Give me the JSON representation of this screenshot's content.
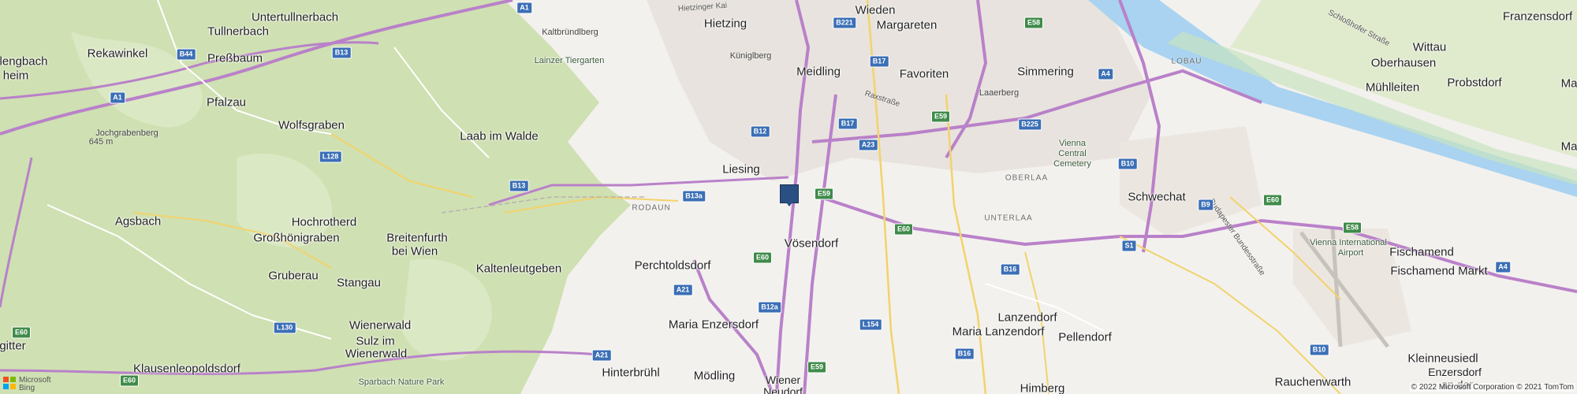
{
  "places": [
    {
      "id": "hietzing",
      "label": "Hietzing"
    },
    {
      "id": "wieden",
      "label": "Wieden"
    },
    {
      "id": "margareten",
      "label": "Margareten"
    },
    {
      "id": "meidling",
      "label": "Meidling"
    },
    {
      "id": "favoriten",
      "label": "Favoriten"
    },
    {
      "id": "simmering",
      "label": "Simmering"
    },
    {
      "id": "liesing",
      "label": "Liesing"
    },
    {
      "id": "schwechat",
      "label": "Schwechat"
    },
    {
      "id": "voesendorf",
      "label": "Vösendorf"
    },
    {
      "id": "perchtoldsdorf",
      "label": "Perchtoldsdorf"
    },
    {
      "id": "maria-enzersdorf",
      "label": "Maria Enzersdorf"
    },
    {
      "id": "hinterbruehl",
      "label": "Hinterbrühl"
    },
    {
      "id": "moedling",
      "label": "Mödling"
    },
    {
      "id": "wiener-neudorf-1",
      "label": "Wiener"
    },
    {
      "id": "wiener-neudorf-2",
      "label": "Neudorf"
    },
    {
      "id": "lanzendorf",
      "label": "Lanzendorf"
    },
    {
      "id": "maria-lanzendorf",
      "label": "Maria Lanzendorf"
    },
    {
      "id": "pellendorf",
      "label": "Pellendorf"
    },
    {
      "id": "himberg",
      "label": "Himberg"
    },
    {
      "id": "rauchenwarth",
      "label": "Rauchenwarth"
    },
    {
      "id": "fischamend",
      "label": "Fischamend"
    },
    {
      "id": "fischamend-markt",
      "label": "Fischamend Markt"
    },
    {
      "id": "kleinneusiedl",
      "label": "Kleinneusiedl"
    },
    {
      "id": "enzersdorf-1",
      "label": "Enzersdorf"
    },
    {
      "id": "enzersdorf-2",
      "label": "an der"
    },
    {
      "id": "muehlleiten",
      "label": "Mühlleiten"
    },
    {
      "id": "oberhausen",
      "label": "Oberhausen"
    },
    {
      "id": "wittau",
      "label": "Wittau"
    },
    {
      "id": "probstdorf",
      "label": "Probstdorf"
    },
    {
      "id": "franzensdorf",
      "label": "Franzensdorf"
    },
    {
      "id": "ma-1",
      "label": "Ma"
    },
    {
      "id": "ma-2",
      "label": "Ma"
    },
    {
      "id": "untertullnerbach",
      "label": "Untertullnerbach"
    },
    {
      "id": "tullnerbach",
      "label": "Tullnerbach"
    },
    {
      "id": "rekawinkel",
      "label": "Rekawinkel"
    },
    {
      "id": "pressbaum",
      "label": "Preßbaum"
    },
    {
      "id": "pfalzau",
      "label": "Pfalzau"
    },
    {
      "id": "wolfsgraben",
      "label": "Wolfsgraben"
    },
    {
      "id": "laab-im-walde",
      "label": "Laab im Walde"
    },
    {
      "id": "agsbach",
      "label": "Agsbach"
    },
    {
      "id": "hochrotherd",
      "label": "Hochrotherd"
    },
    {
      "id": "grosshoenigraben",
      "label": "Großhönigraben"
    },
    {
      "id": "breitenfurth-1",
      "label": "Breitenfurth"
    },
    {
      "id": "breitenfurth-2",
      "label": "bei Wien"
    },
    {
      "id": "kaltenleutgeben",
      "label": "Kaltenleutgeben"
    },
    {
      "id": "gruberau",
      "label": "Gruberau"
    },
    {
      "id": "stangau",
      "label": "Stangau"
    },
    {
      "id": "wienerwald",
      "label": "Wienerwald"
    },
    {
      "id": "sulz-1",
      "label": "Sulz im"
    },
    {
      "id": "sulz-2",
      "label": "Wienerwald"
    },
    {
      "id": "klausen",
      "label": "Klausenleopoldsdorf"
    },
    {
      "id": "gitter",
      "label": "gitter"
    },
    {
      "id": "lengbach",
      "label": "lengbach"
    },
    {
      "id": "heim",
      "label": "heim"
    }
  ],
  "pois": [
    {
      "id": "kaltbruendlberg",
      "label": "Kaltbründlberg"
    },
    {
      "id": "lainzer-tiergarten",
      "label": "Lainzer Tiergarten"
    },
    {
      "id": "kueniglberg",
      "label": "Küniglberg"
    },
    {
      "id": "laaerberg",
      "label": "Laaerberg"
    },
    {
      "id": "vienna-cemetery-1",
      "label": "Vienna"
    },
    {
      "id": "vienna-cemetery-2",
      "label": "Central"
    },
    {
      "id": "vienna-cemetery-3",
      "label": "Cemetery"
    },
    {
      "id": "airport-1",
      "label": "Vienna International"
    },
    {
      "id": "airport-2",
      "label": "Airport"
    },
    {
      "id": "sparbach",
      "label": "Sparbach Nature Park"
    },
    {
      "id": "jochgrabenberg-1",
      "label": "Jochgrabenberg"
    },
    {
      "id": "jochgrabenberg-2",
      "label": "645 m"
    }
  ],
  "districts": [
    {
      "id": "rodaun",
      "label": "RODAUN"
    },
    {
      "id": "oberlaa",
      "label": "OBERLAA"
    },
    {
      "id": "unterlaa",
      "label": "UNTERLAA"
    },
    {
      "id": "lobau",
      "label": "LOBAU"
    }
  ],
  "shields": [
    {
      "id": "a1-top",
      "label": "A1",
      "color": "#3b6fb6"
    },
    {
      "id": "b221",
      "label": "B221",
      "color": "#3b6fb6"
    },
    {
      "id": "e58-top",
      "label": "E58",
      "color": "#3f8b4a"
    },
    {
      "id": "b44",
      "label": "B44",
      "color": "#3b6fb6"
    },
    {
      "id": "b13-top",
      "label": "B13",
      "color": "#3b6fb6"
    },
    {
      "id": "a1-left",
      "label": "A1",
      "color": "#3b6fb6"
    },
    {
      "id": "b17-a",
      "label": "B17",
      "color": "#3b6fb6"
    },
    {
      "id": "b17-b",
      "label": "B17",
      "color": "#3b6fb6"
    },
    {
      "id": "b12",
      "label": "B12",
      "color": "#3b6fb6"
    },
    {
      "id": "a23",
      "label": "A23",
      "color": "#3b6fb6"
    },
    {
      "id": "e59-a",
      "label": "E59",
      "color": "#3f8b4a"
    },
    {
      "id": "b225",
      "label": "B225",
      "color": "#3b6fb6"
    },
    {
      "id": "a4-top",
      "label": "A4",
      "color": "#3b6fb6"
    },
    {
      "id": "l128",
      "label": "L128",
      "color": "#3b6fb6"
    },
    {
      "id": "b13-mid",
      "label": "B13",
      "color": "#3b6fb6"
    },
    {
      "id": "b13a",
      "label": "B13a",
      "color": "#3b6fb6"
    },
    {
      "id": "e59-b",
      "label": "E59",
      "color": "#3f8b4a"
    },
    {
      "id": "b10-a",
      "label": "B10",
      "color": "#3b6fb6"
    },
    {
      "id": "b9",
      "label": "B9",
      "color": "#3b6fb6"
    },
    {
      "id": "e60-a",
      "label": "E60",
      "color": "#3f8b4a"
    },
    {
      "id": "e60-b",
      "label": "E60",
      "color": "#3f8b4a"
    },
    {
      "id": "e60-c",
      "label": "E60",
      "color": "#3f8b4a"
    },
    {
      "id": "s1",
      "label": "S1",
      "color": "#3b6fb6"
    },
    {
      "id": "e58-r",
      "label": "E58",
      "color": "#3f8b4a"
    },
    {
      "id": "b16-a",
      "label": "B16",
      "color": "#3b6fb6"
    },
    {
      "id": "a21",
      "label": "A21",
      "color": "#3b6fb6"
    },
    {
      "id": "b12a",
      "label": "B12a",
      "color": "#3b6fb6"
    },
    {
      "id": "l154",
      "label": "L154",
      "color": "#3b6fb6"
    },
    {
      "id": "l130",
      "label": "L130",
      "color": "#3b6fb6"
    },
    {
      "id": "e60-l",
      "label": "E60",
      "color": "#3f8b4a"
    },
    {
      "id": "a21-b",
      "label": "A21",
      "color": "#3b6fb6"
    },
    {
      "id": "b16-b",
      "label": "B16",
      "color": "#3b6fb6"
    },
    {
      "id": "b10-b",
      "label": "B10",
      "color": "#3b6fb6"
    },
    {
      "id": "a4-r",
      "label": "A4",
      "color": "#3b6fb6"
    },
    {
      "id": "e59-c",
      "label": "E59",
      "color": "#3f8b4a"
    },
    {
      "id": "e60-bot",
      "label": "E60",
      "color": "#3f8b4a"
    }
  ],
  "roadnames": [
    {
      "id": "hietzinger-kai",
      "label": "Hietzinger Kai"
    },
    {
      "id": "raxstrasse",
      "label": "Raxstraße"
    },
    {
      "id": "budapester",
      "label": "Budapester Bundesstraße"
    },
    {
      "id": "schlosshofer",
      "label": "Schloßhofer Straße"
    }
  ],
  "pin": {
    "label": "location-pin",
    "color": "#2a4f82"
  },
  "attribution": {
    "logo_line1": "Microsoft",
    "logo_line2": "Bing",
    "copyright": "© 2022 Microsoft Corporation © 2021 TomTom"
  },
  "colors": {
    "forest": "#cfe0b2",
    "land": "#f3f1ee",
    "water": "#a9d3f0",
    "motorway": "#b981c9",
    "urban": "#e8e3de"
  }
}
